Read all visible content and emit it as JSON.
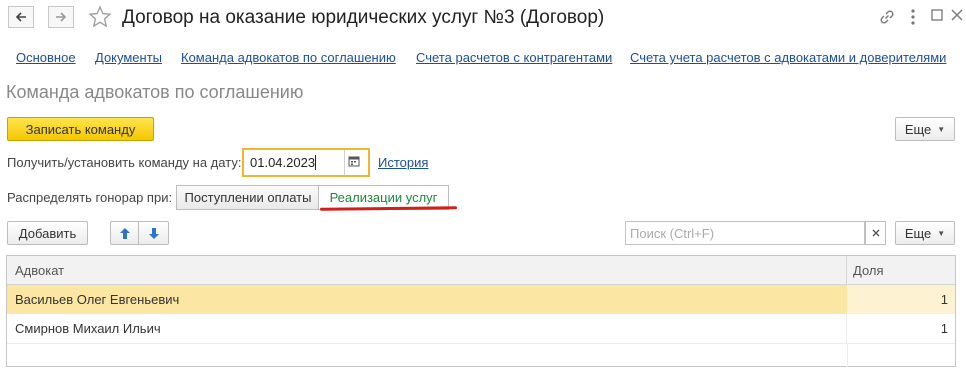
{
  "window": {
    "title": "Договор на оказание юридических услуг №3 (Договор)"
  },
  "nav_links": [
    "Основное",
    "Документы",
    "Команда адвокатов по соглашению",
    "Счета расчетов с контрагентами",
    "Счета учета расчетов с адвокатами и доверителями"
  ],
  "section": {
    "title": "Команда адвокатов по соглашению"
  },
  "toolbar": {
    "save_team_label": "Записать команду",
    "more_label": "Еще"
  },
  "date_row": {
    "label": "Получить/установить команду на дату:",
    "date_value": "01.04.2023",
    "history_label": "История"
  },
  "distribute_row": {
    "label": "Распределять гонорар при:",
    "options": [
      "Поступлении оплаты",
      "Реализации услуг"
    ],
    "selected": "Реализации услуг"
  },
  "table_toolbar": {
    "add_label": "Добавить",
    "search_placeholder": "Поиск (Ctrl+F)",
    "more_label": "Еще"
  },
  "table": {
    "columns": [
      "Адвокат",
      "Доля"
    ],
    "rows": [
      {
        "lawyer": "Васильев Олег Евгеньевич",
        "share": "1",
        "selected": true
      },
      {
        "lawyer": "Смирнов Михаил Ильич",
        "share": "1",
        "selected": false
      }
    ]
  },
  "colors": {
    "accent_yellow": "#f4c800",
    "link_blue": "#1a4f9c",
    "selected_row": "#fbe6a4",
    "active_toggle_text": "#1c8a3c",
    "underline_red": "#d0201a"
  }
}
